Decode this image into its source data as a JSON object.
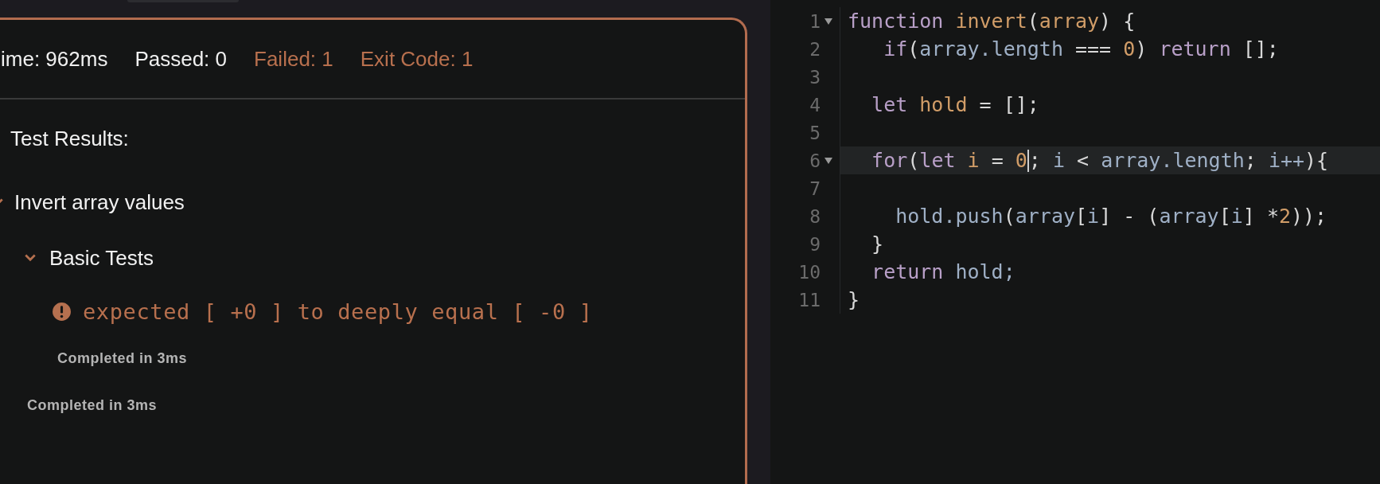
{
  "stats": [
    {
      "label": "ime: 962ms",
      "failed": false
    },
    {
      "label": "Passed: 0",
      "failed": false
    },
    {
      "label": "Failed: 1",
      "failed": true
    },
    {
      "label": "Exit Code: 1",
      "failed": true
    }
  ],
  "results": {
    "heading": "Test Results:",
    "groups": [
      {
        "title": "Invert array values",
        "expanded": true,
        "completed": "Completed in 3ms",
        "children": [
          {
            "title": "Basic Tests",
            "expanded": true,
            "failures": [
              "expected [ +0 ] to deeply equal [ -0 ]"
            ],
            "completed": "Completed in 3ms"
          }
        ]
      }
    ]
  },
  "editor": {
    "lines": [
      {
        "number": "1",
        "foldable": true,
        "active": false,
        "tokens": [
          {
            "t": "function ",
            "kind": "keyword"
          },
          {
            "t": "invert",
            "kind": "name"
          },
          {
            "t": "("
          },
          {
            "t": "array",
            "kind": "name"
          },
          {
            "t": ") {"
          }
        ]
      },
      {
        "number": "2",
        "foldable": false,
        "active": false,
        "tokens": [
          {
            "t": "   if",
            "kind": "keyword"
          },
          {
            "t": "("
          },
          {
            "t": "array.length",
            "kind": "ident"
          },
          {
            "t": " === "
          },
          {
            "t": "0",
            "kind": "number"
          },
          {
            "t": ") "
          },
          {
            "t": "return",
            "kind": "keyword"
          },
          {
            "t": " [];"
          }
        ]
      },
      {
        "number": "3",
        "foldable": false,
        "active": false
      },
      {
        "number": "4",
        "foldable": false,
        "active": false,
        "tokens": [
          {
            "t": "  let ",
            "kind": "keyword"
          },
          {
            "t": "hold",
            "kind": "name"
          },
          {
            "t": " = [];"
          }
        ]
      },
      {
        "number": "5",
        "foldable": false,
        "active": false
      },
      {
        "number": "6",
        "foldable": true,
        "active": true,
        "tokens": [
          {
            "t": "  for",
            "kind": "keyword"
          },
          {
            "t": "("
          },
          {
            "t": "let ",
            "kind": "keyword"
          },
          {
            "t": "i",
            "kind": "name"
          },
          {
            "t": " = "
          },
          {
            "t": "0",
            "kind": "number",
            "cursor_after": true
          },
          {
            "t": "; "
          },
          {
            "t": "i",
            "kind": "ident"
          },
          {
            "t": " < "
          },
          {
            "t": "array.length",
            "kind": "ident"
          },
          {
            "t": "; "
          },
          {
            "t": "i++",
            "kind": "ident"
          },
          {
            "t": "){"
          }
        ]
      },
      {
        "number": "7",
        "foldable": false,
        "active": false
      },
      {
        "number": "8",
        "foldable": false,
        "active": false,
        "tokens": [
          {
            "t": "    hold.push",
            "kind": "ident"
          },
          {
            "t": "("
          },
          {
            "t": "array",
            "kind": "ident"
          },
          {
            "t": "["
          },
          {
            "t": "i",
            "kind": "ident"
          },
          {
            "t": "] - ("
          },
          {
            "t": "array",
            "kind": "ident"
          },
          {
            "t": "["
          },
          {
            "t": "i",
            "kind": "ident"
          },
          {
            "t": "] *"
          },
          {
            "t": "2",
            "kind": "number"
          },
          {
            "t": "));"
          }
        ]
      },
      {
        "number": "9",
        "foldable": false,
        "active": false,
        "tokens": [
          {
            "t": "  }"
          }
        ]
      },
      {
        "number": "10",
        "foldable": false,
        "active": false,
        "tokens": [
          {
            "t": "  return ",
            "kind": "keyword"
          },
          {
            "t": "hold;",
            "kind": "ident"
          }
        ]
      },
      {
        "number": "11",
        "foldable": false,
        "active": false,
        "tokens": [
          {
            "t": "}"
          }
        ]
      }
    ]
  }
}
